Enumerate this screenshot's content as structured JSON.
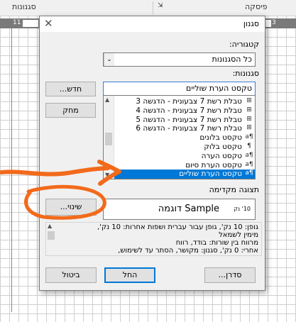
{
  "background": {
    "ribbon_groups": [
      "סגנונות",
      "פיסקה"
    ],
    "ruler_left": "11",
    "ruler_right": "3"
  },
  "dialog": {
    "title": "סגנון",
    "close_glyph": "✕",
    "category_label": "קטגוריה:",
    "category_value": "כל הסגנונות",
    "styles_label": "סגנונות:",
    "styles_value": "טקסט הערת שוליים",
    "new_button": "חדש...",
    "delete_button": "מחק",
    "modify_button": "שינוי...",
    "organizer_button": "סדרן...",
    "apply_button": "החל",
    "cancel_button": "ביטול",
    "preview_label": "תצוגה מקדימה",
    "preview_sample": "Sample דוגמה",
    "preview_size": "10' נק",
    "styles_list": [
      {
        "label": "טבלת רשת 7 צבעונית - הדגשה 3",
        "icon": "table-grid-icon",
        "glyph": "⊞",
        "selected": false
      },
      {
        "label": "טבלת רשת 7 צבעונית - הדגשה 4",
        "icon": "table-grid-icon",
        "glyph": "⊞",
        "selected": false
      },
      {
        "label": "טבלת רשת 7 צבעונית - הדגשה 5",
        "icon": "table-grid-icon",
        "glyph": "⊞",
        "selected": false
      },
      {
        "label": "טבלת רשת 7 צבעונית - הדגשה 6",
        "icon": "table-grid-icon",
        "glyph": "⊞",
        "selected": false
      },
      {
        "label": "טקסט בלונים",
        "icon": "linked-style-icon",
        "glyph": "¶a",
        "selected": false
      },
      {
        "label": "טקסט בלוק",
        "icon": "paragraph-icon",
        "glyph": "¶",
        "selected": false
      },
      {
        "label": "טקסט הערה",
        "icon": "linked-style-icon",
        "glyph": "¶a",
        "selected": false
      },
      {
        "label": "טקסט הערת סיום",
        "icon": "linked-style-icon",
        "glyph": "¶a",
        "selected": false
      },
      {
        "label": "טקסט הערת שוליים",
        "icon": "linked-style-icon",
        "glyph": "¶a",
        "selected": true
      }
    ],
    "description_lines": [
      "גופן: 10 נק', גופן עבור עברית ושפות אחרות: 10 נק',",
      "מימין לשמאל",
      "מרווח בין שורות:  בודד, רווח",
      "אחרי:  0 נק', סגנון: מקושר, הסתר עד לשימוש,"
    ]
  },
  "annotations": {
    "color": "#f26a1b"
  }
}
